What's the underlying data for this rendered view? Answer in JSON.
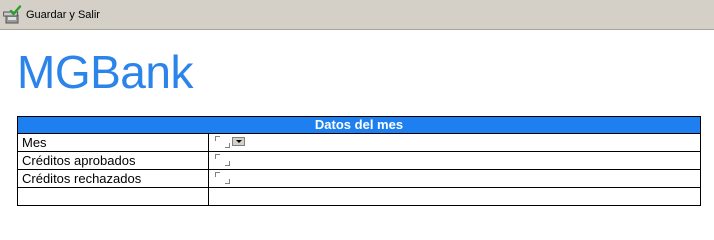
{
  "toolbar": {
    "save_exit_label": "Guardar y Salir",
    "save_exit_icon": "save-exit-icon"
  },
  "logo": {
    "text": "MGBank",
    "color": "#2b84ea"
  },
  "form": {
    "header": "Datos del mes",
    "header_color": "#1e7ff0",
    "rows": [
      {
        "label": "Mes",
        "value": "",
        "control": "dropdown"
      },
      {
        "label": "Créditos aprobados",
        "value": "",
        "control": "text"
      },
      {
        "label": "Créditos rechazados",
        "value": "",
        "control": "text"
      },
      {
        "label": "",
        "value": "",
        "control": "none"
      }
    ]
  }
}
